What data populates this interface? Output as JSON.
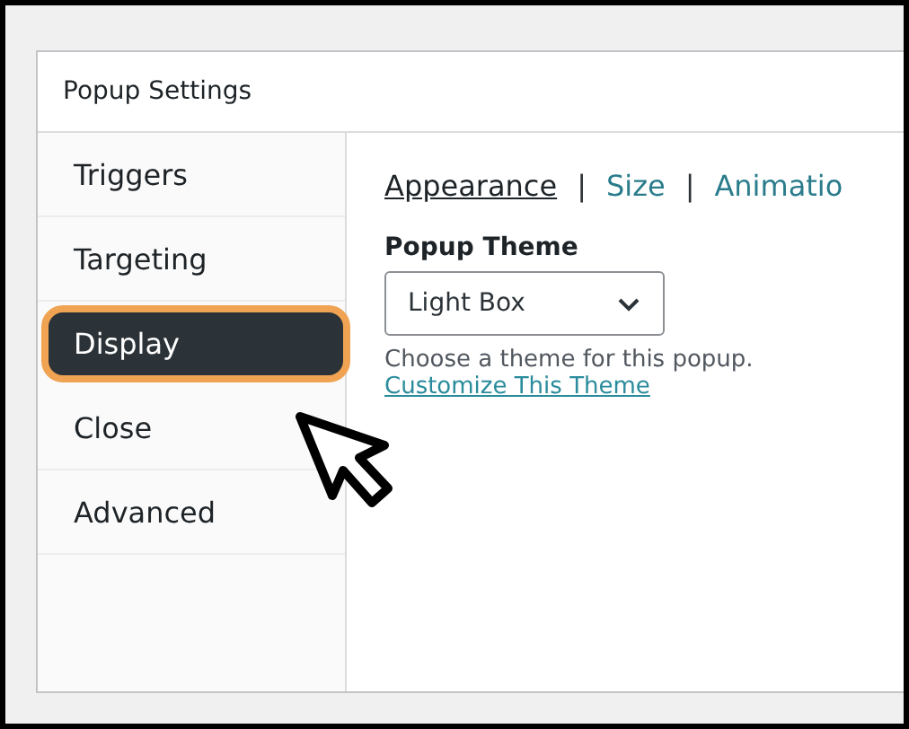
{
  "panel": {
    "title": "Popup Settings"
  },
  "sidebar": {
    "items": [
      {
        "label": "Triggers",
        "selected": false
      },
      {
        "label": "Targeting",
        "selected": false
      },
      {
        "label": "Display",
        "selected": true
      },
      {
        "label": "Close",
        "selected": false
      },
      {
        "label": "Advanced",
        "selected": false
      }
    ]
  },
  "tabs": [
    {
      "label": "Appearance",
      "selected": true,
      "separator": "|"
    },
    {
      "label": "Size",
      "selected": false,
      "separator": "|"
    },
    {
      "label": "Animatio",
      "selected": false
    }
  ],
  "theme": {
    "label": "Popup Theme",
    "value": "Light Box",
    "help": "Choose a theme for this popup.",
    "link": "Customize This Theme"
  }
}
